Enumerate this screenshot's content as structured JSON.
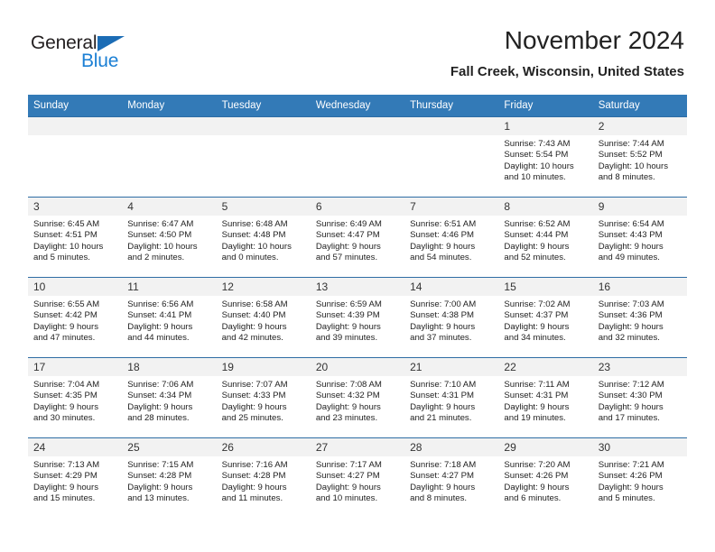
{
  "logo": {
    "word_one": "General",
    "word_two": "Blue",
    "triangle": "blue-triangle-icon",
    "accent_dark": "#231f20",
    "accent_blue": "#1b7fd4",
    "triangle_color": "#1b6cb5"
  },
  "header": {
    "title": "November 2024",
    "subtitle": "Fall Creek, Wisconsin, United States"
  },
  "theme": {
    "header_bg": "#337ab7",
    "header_text": "#ffffff",
    "daynum_bg": "#f2f2f2",
    "row_border": "#2e6da4",
    "body_bg": "#ffffff"
  },
  "weekdays": [
    "Sunday",
    "Monday",
    "Tuesday",
    "Wednesday",
    "Thursday",
    "Friday",
    "Saturday"
  ],
  "weeks": [
    [
      {
        "empty": true,
        "day": ""
      },
      {
        "empty": true,
        "day": ""
      },
      {
        "empty": true,
        "day": ""
      },
      {
        "empty": true,
        "day": ""
      },
      {
        "empty": true,
        "day": ""
      },
      {
        "empty": false,
        "day": "1",
        "sunrise": "Sunrise: 7:43 AM",
        "sunset": "Sunset: 5:54 PM",
        "daylight_1": "Daylight: 10 hours",
        "daylight_2": "and 10 minutes."
      },
      {
        "empty": false,
        "day": "2",
        "sunrise": "Sunrise: 7:44 AM",
        "sunset": "Sunset: 5:52 PM",
        "daylight_1": "Daylight: 10 hours",
        "daylight_2": "and 8 minutes."
      }
    ],
    [
      {
        "empty": false,
        "day": "3",
        "sunrise": "Sunrise: 6:45 AM",
        "sunset": "Sunset: 4:51 PM",
        "daylight_1": "Daylight: 10 hours",
        "daylight_2": "and 5 minutes."
      },
      {
        "empty": false,
        "day": "4",
        "sunrise": "Sunrise: 6:47 AM",
        "sunset": "Sunset: 4:50 PM",
        "daylight_1": "Daylight: 10 hours",
        "daylight_2": "and 2 minutes."
      },
      {
        "empty": false,
        "day": "5",
        "sunrise": "Sunrise: 6:48 AM",
        "sunset": "Sunset: 4:48 PM",
        "daylight_1": "Daylight: 10 hours",
        "daylight_2": "and 0 minutes."
      },
      {
        "empty": false,
        "day": "6",
        "sunrise": "Sunrise: 6:49 AM",
        "sunset": "Sunset: 4:47 PM",
        "daylight_1": "Daylight: 9 hours",
        "daylight_2": "and 57 minutes."
      },
      {
        "empty": false,
        "day": "7",
        "sunrise": "Sunrise: 6:51 AM",
        "sunset": "Sunset: 4:46 PM",
        "daylight_1": "Daylight: 9 hours",
        "daylight_2": "and 54 minutes."
      },
      {
        "empty": false,
        "day": "8",
        "sunrise": "Sunrise: 6:52 AM",
        "sunset": "Sunset: 4:44 PM",
        "daylight_1": "Daylight: 9 hours",
        "daylight_2": "and 52 minutes."
      },
      {
        "empty": false,
        "day": "9",
        "sunrise": "Sunrise: 6:54 AM",
        "sunset": "Sunset: 4:43 PM",
        "daylight_1": "Daylight: 9 hours",
        "daylight_2": "and 49 minutes."
      }
    ],
    [
      {
        "empty": false,
        "day": "10",
        "sunrise": "Sunrise: 6:55 AM",
        "sunset": "Sunset: 4:42 PM",
        "daylight_1": "Daylight: 9 hours",
        "daylight_2": "and 47 minutes."
      },
      {
        "empty": false,
        "day": "11",
        "sunrise": "Sunrise: 6:56 AM",
        "sunset": "Sunset: 4:41 PM",
        "daylight_1": "Daylight: 9 hours",
        "daylight_2": "and 44 minutes."
      },
      {
        "empty": false,
        "day": "12",
        "sunrise": "Sunrise: 6:58 AM",
        "sunset": "Sunset: 4:40 PM",
        "daylight_1": "Daylight: 9 hours",
        "daylight_2": "and 42 minutes."
      },
      {
        "empty": false,
        "day": "13",
        "sunrise": "Sunrise: 6:59 AM",
        "sunset": "Sunset: 4:39 PM",
        "daylight_1": "Daylight: 9 hours",
        "daylight_2": "and 39 minutes."
      },
      {
        "empty": false,
        "day": "14",
        "sunrise": "Sunrise: 7:00 AM",
        "sunset": "Sunset: 4:38 PM",
        "daylight_1": "Daylight: 9 hours",
        "daylight_2": "and 37 minutes."
      },
      {
        "empty": false,
        "day": "15",
        "sunrise": "Sunrise: 7:02 AM",
        "sunset": "Sunset: 4:37 PM",
        "daylight_1": "Daylight: 9 hours",
        "daylight_2": "and 34 minutes."
      },
      {
        "empty": false,
        "day": "16",
        "sunrise": "Sunrise: 7:03 AM",
        "sunset": "Sunset: 4:36 PM",
        "daylight_1": "Daylight: 9 hours",
        "daylight_2": "and 32 minutes."
      }
    ],
    [
      {
        "empty": false,
        "day": "17",
        "sunrise": "Sunrise: 7:04 AM",
        "sunset": "Sunset: 4:35 PM",
        "daylight_1": "Daylight: 9 hours",
        "daylight_2": "and 30 minutes."
      },
      {
        "empty": false,
        "day": "18",
        "sunrise": "Sunrise: 7:06 AM",
        "sunset": "Sunset: 4:34 PM",
        "daylight_1": "Daylight: 9 hours",
        "daylight_2": "and 28 minutes."
      },
      {
        "empty": false,
        "day": "19",
        "sunrise": "Sunrise: 7:07 AM",
        "sunset": "Sunset: 4:33 PM",
        "daylight_1": "Daylight: 9 hours",
        "daylight_2": "and 25 minutes."
      },
      {
        "empty": false,
        "day": "20",
        "sunrise": "Sunrise: 7:08 AM",
        "sunset": "Sunset: 4:32 PM",
        "daylight_1": "Daylight: 9 hours",
        "daylight_2": "and 23 minutes."
      },
      {
        "empty": false,
        "day": "21",
        "sunrise": "Sunrise: 7:10 AM",
        "sunset": "Sunset: 4:31 PM",
        "daylight_1": "Daylight: 9 hours",
        "daylight_2": "and 21 minutes."
      },
      {
        "empty": false,
        "day": "22",
        "sunrise": "Sunrise: 7:11 AM",
        "sunset": "Sunset: 4:31 PM",
        "daylight_1": "Daylight: 9 hours",
        "daylight_2": "and 19 minutes."
      },
      {
        "empty": false,
        "day": "23",
        "sunrise": "Sunrise: 7:12 AM",
        "sunset": "Sunset: 4:30 PM",
        "daylight_1": "Daylight: 9 hours",
        "daylight_2": "and 17 minutes."
      }
    ],
    [
      {
        "empty": false,
        "day": "24",
        "sunrise": "Sunrise: 7:13 AM",
        "sunset": "Sunset: 4:29 PM",
        "daylight_1": "Daylight: 9 hours",
        "daylight_2": "and 15 minutes."
      },
      {
        "empty": false,
        "day": "25",
        "sunrise": "Sunrise: 7:15 AM",
        "sunset": "Sunset: 4:28 PM",
        "daylight_1": "Daylight: 9 hours",
        "daylight_2": "and 13 minutes."
      },
      {
        "empty": false,
        "day": "26",
        "sunrise": "Sunrise: 7:16 AM",
        "sunset": "Sunset: 4:28 PM",
        "daylight_1": "Daylight: 9 hours",
        "daylight_2": "and 11 minutes."
      },
      {
        "empty": false,
        "day": "27",
        "sunrise": "Sunrise: 7:17 AM",
        "sunset": "Sunset: 4:27 PM",
        "daylight_1": "Daylight: 9 hours",
        "daylight_2": "and 10 minutes."
      },
      {
        "empty": false,
        "day": "28",
        "sunrise": "Sunrise: 7:18 AM",
        "sunset": "Sunset: 4:27 PM",
        "daylight_1": "Daylight: 9 hours",
        "daylight_2": "and 8 minutes."
      },
      {
        "empty": false,
        "day": "29",
        "sunrise": "Sunrise: 7:20 AM",
        "sunset": "Sunset: 4:26 PM",
        "daylight_1": "Daylight: 9 hours",
        "daylight_2": "and 6 minutes."
      },
      {
        "empty": false,
        "day": "30",
        "sunrise": "Sunrise: 7:21 AM",
        "sunset": "Sunset: 4:26 PM",
        "daylight_1": "Daylight: 9 hours",
        "daylight_2": "and 5 minutes."
      }
    ]
  ]
}
